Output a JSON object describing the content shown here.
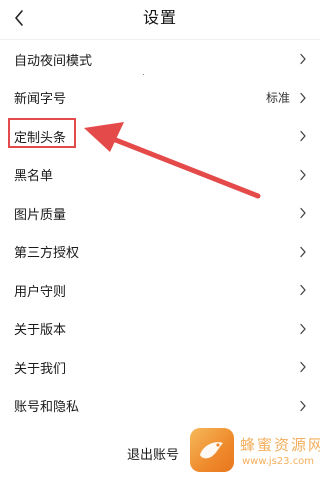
{
  "header": {
    "title": "设置"
  },
  "settings": {
    "items": [
      {
        "label": "自动夜间模式",
        "value": ""
      },
      {
        "label": "新闻字号",
        "value": "标准"
      },
      {
        "label": "定制头条",
        "value": ""
      },
      {
        "label": "黑名单",
        "value": ""
      },
      {
        "label": "图片质量",
        "value": ""
      },
      {
        "label": "第三方授权",
        "value": ""
      },
      {
        "label": "用户守则",
        "value": ""
      },
      {
        "label": "关于版本",
        "value": ""
      },
      {
        "label": "关于我们",
        "value": ""
      },
      {
        "label": "账号和隐私",
        "value": ""
      }
    ]
  },
  "footer": {
    "logout_label": "退出账号"
  },
  "watermark": {
    "title": "蜂蜜资源网",
    "url": "www.js23.com"
  },
  "colors": {
    "annotation_red": "#e54a4a",
    "watermark_orange": "#f0a040",
    "text": "#1a1a1a",
    "background": "#ffffff"
  },
  "icons": {
    "back": "chevron-left-icon",
    "row_arrow": "chevron-right-icon"
  }
}
